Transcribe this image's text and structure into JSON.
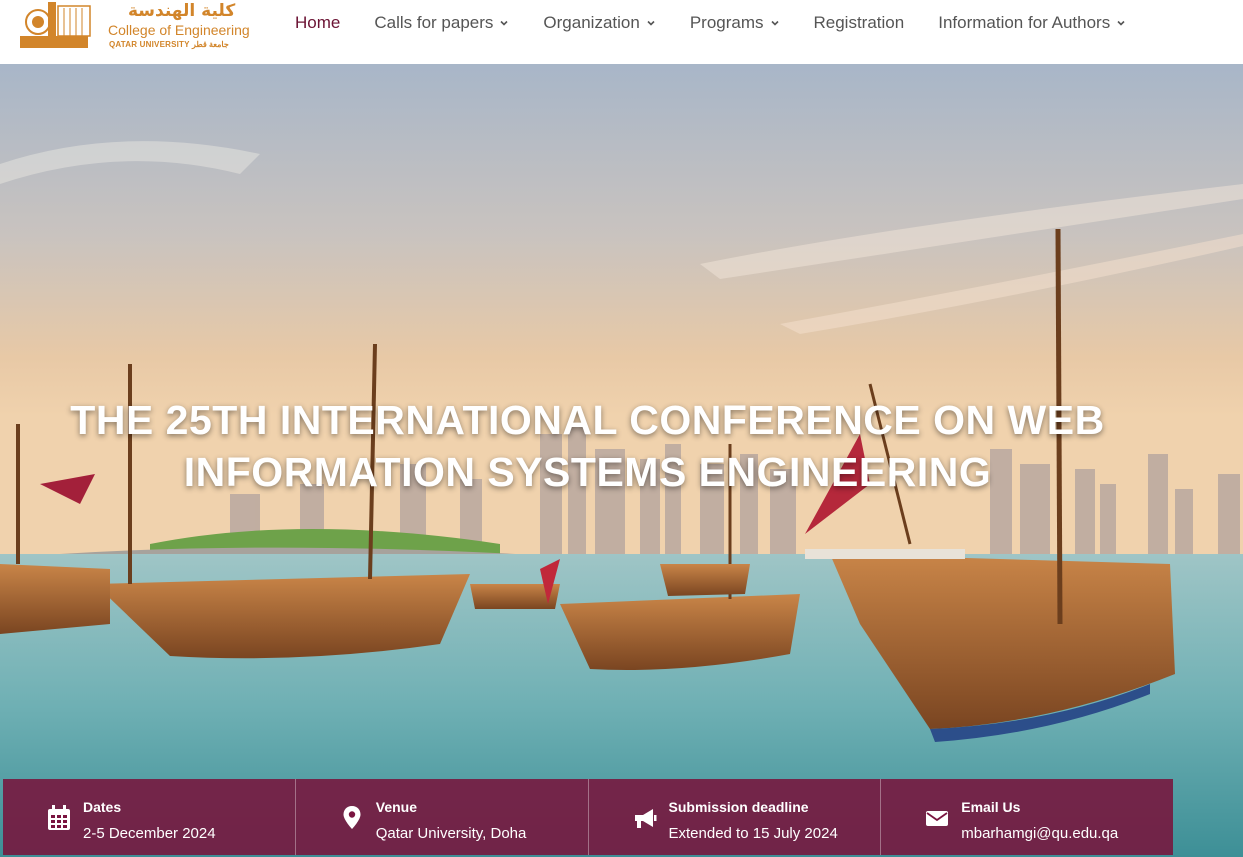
{
  "logo": {
    "arabic_name": "كلية الهندسة",
    "english_name": "College of Engineering",
    "university": "QATAR UNIVERSITY جامعة قطر"
  },
  "nav": {
    "items": [
      {
        "label": "Home",
        "active": true,
        "dropdown": false
      },
      {
        "label": "Calls for papers",
        "active": false,
        "dropdown": true
      },
      {
        "label": "Organization",
        "active": false,
        "dropdown": true
      },
      {
        "label": "Programs",
        "active": false,
        "dropdown": true
      },
      {
        "label": "Registration",
        "active": false,
        "dropdown": false
      },
      {
        "label": "Information for Authors",
        "active": false,
        "dropdown": true
      }
    ]
  },
  "hero": {
    "title": "THE 25TH INTERNATIONAL CONFERENCE ON WEB INFORMATION SYSTEMS ENGINEERING"
  },
  "info": [
    {
      "icon": "calendar-icon",
      "title": "Dates",
      "value": "2-5 December 2024"
    },
    {
      "icon": "location-pin-icon",
      "title": "Venue",
      "value": "Qatar University, Doha"
    },
    {
      "icon": "megaphone-icon",
      "title": "Submission deadline",
      "value": "Extended to 15 July 2024"
    },
    {
      "icon": "envelope-icon",
      "title": "Email Us",
      "value": "mbarhamgi@qu.edu.qa"
    }
  ],
  "colors": {
    "brand_gold": "#d2852a",
    "accent_maroon": "#6b1233",
    "info_bar": "#78143c"
  }
}
